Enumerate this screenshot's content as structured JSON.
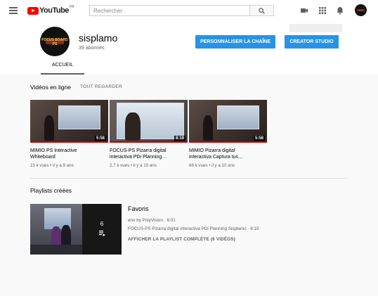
{
  "topbar": {
    "logo_text": "YouTube",
    "logo_region": "FR",
    "search_placeholder": "Rechercher"
  },
  "channel": {
    "avatar_text": "FOCUS BOARD PS",
    "name": "sisplamo",
    "subscribers": "39 abonnés",
    "customize_button": "PERSONNALISER LA CHAÎNE",
    "studio_button": "CREATOR STUDIO",
    "tabs": [
      {
        "label": "ACCUEIL",
        "active": true
      }
    ]
  },
  "uploads": {
    "title": "Vidéos en ligne",
    "see_all": "TOUT REGARDER",
    "videos": [
      {
        "title_line1": "MIMIO PS Interactive",
        "title_line2": "Whiteboard",
        "duration": "5:58",
        "views": "15 k vues",
        "age": "il y a 9 ans"
      },
      {
        "title_line1": "FOCUS-PS Pizarra digital",
        "title_line2": "interactiva PDi Planning…",
        "duration": "8:19",
        "views": "2,7 k vues",
        "age": "il y a 10 ans"
      },
      {
        "title_line1": "MIMIO Pizarra digital",
        "title_line2": "interactiva Captura tus…",
        "duration": "5:58",
        "views": "66 k vues",
        "age": "il y a 10 ans"
      }
    ]
  },
  "playlists": {
    "title": "Playlists créées",
    "items": [
      {
        "name": "Favoris",
        "count": "6",
        "line1": "eno by PolyVision · 6:01",
        "line2": "FOCUS-PS Pizarra digital interactiva PDi Planning Sisplamo · 8:19",
        "link": "AFFICHER LA PLAYLIST COMPLÈTE (6 VIDÉOS)"
      }
    ]
  },
  "colors": {
    "brand_red": "#ff0000",
    "accent_blue": "#2793e6",
    "progress_red": "#cc0000"
  }
}
